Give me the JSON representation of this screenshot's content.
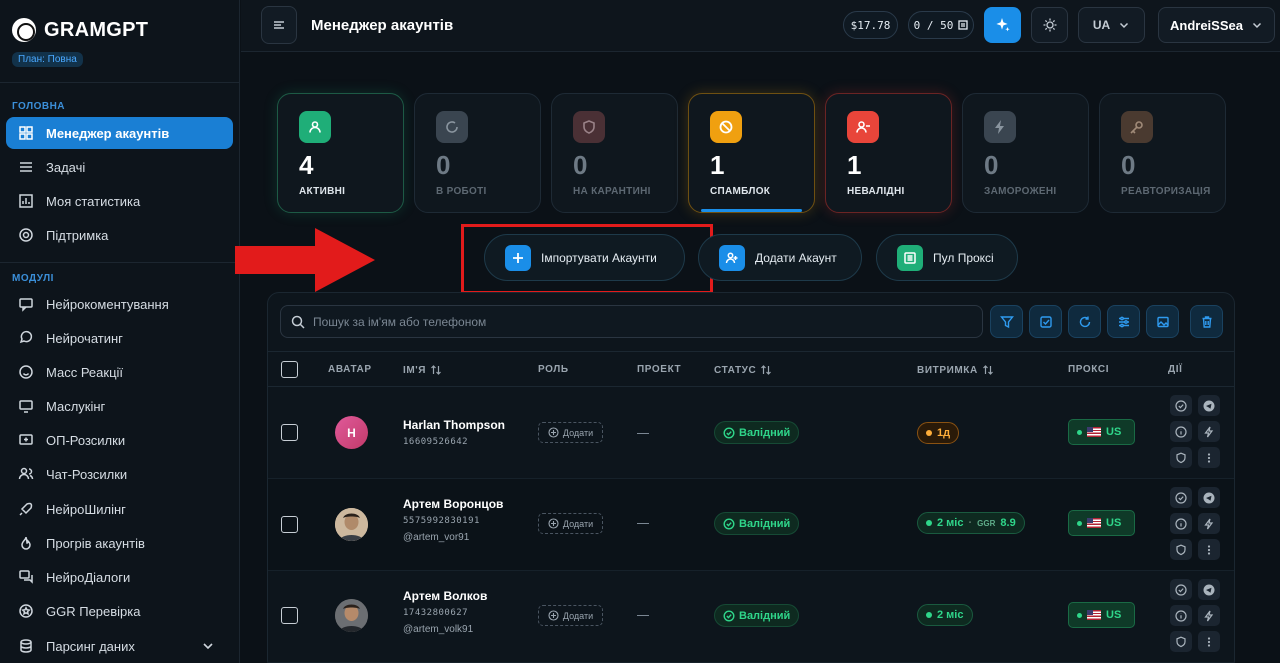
{
  "brand": {
    "title": "GRAMGPT",
    "plan": "План: Повна"
  },
  "sidebar": {
    "section_main": "ГОЛОВНА",
    "main_items": [
      {
        "label": "Менеджер акаунтів",
        "icon": "grid-icon",
        "active": true
      },
      {
        "label": "Задачі",
        "icon": "list-icon"
      },
      {
        "label": "Моя статистика",
        "icon": "chart-icon"
      },
      {
        "label": "Підтримка",
        "icon": "lifebuoy-icon"
      }
    ],
    "section_modules": "МОДУЛІ",
    "module_items": [
      {
        "label": "Нейрокоментування",
        "icon": "comment-icon"
      },
      {
        "label": "Нейрочатинг",
        "icon": "chat-icon"
      },
      {
        "label": "Масс Реакції",
        "icon": "smile-icon"
      },
      {
        "label": "Маслукінг",
        "icon": "monitor-icon"
      },
      {
        "label": "ОП-Розсилки",
        "icon": "message-plus-icon"
      },
      {
        "label": "Чат-Розсилки",
        "icon": "users-icon"
      },
      {
        "label": "НейроШилінг",
        "icon": "rocket-icon"
      },
      {
        "label": "Прогрів акаунтів",
        "icon": "fire-icon"
      },
      {
        "label": "НейроДіалоги",
        "icon": "dialog-icon"
      },
      {
        "label": "GGR Перевірка",
        "icon": "star-badge-icon"
      },
      {
        "label": "Парсинг даних",
        "icon": "database-icon"
      }
    ]
  },
  "header": {
    "title": "Менеджер акаунтів",
    "balance": "$17.78",
    "quota": "0 / 50",
    "language": "UA",
    "user": "AndreiSSea"
  },
  "stats": [
    {
      "value": "4",
      "label": "АКТИВНІ",
      "icon": "user-icon",
      "color": "#1fae78"
    },
    {
      "value": "0",
      "label": "В РОБОТІ",
      "icon": "refresh-icon",
      "color": "#3a4550"
    },
    {
      "value": "0",
      "label": "НА КАРАНТИНІ",
      "icon": "shield-icon",
      "color": "#4a3035"
    },
    {
      "value": "1",
      "label": "СПАМБЛОК",
      "icon": "ban-icon",
      "color": "#f0a010"
    },
    {
      "value": "1",
      "label": "НЕВАЛІДНІ",
      "icon": "user-x-icon",
      "color": "#e8453a"
    },
    {
      "value": "0",
      "label": "ЗАМОРОЖЕНІ",
      "icon": "bolt-icon",
      "color": "#3a4550"
    },
    {
      "value": "0",
      "label": "РЕАВТОРИЗАЦІЯ",
      "icon": "key-icon",
      "color": "#4a3a30"
    }
  ],
  "actions": {
    "import": "Імпортувати Акаунти",
    "add": "Додати Акаунт",
    "proxy_pool": "Пул Проксі"
  },
  "table": {
    "search_placeholder": "Пошук за ім'ям або телефоном",
    "headers": {
      "avatar": "АВАТАР",
      "name": "ІМ'Я",
      "role": "РОЛЬ",
      "project": "ПРОЕКТ",
      "status": "СТАТУС",
      "endurance": "ВИТРИМКА",
      "proxy": "ПРОКСІ",
      "actions": "ДІЇ"
    },
    "role_add": "Додати",
    "project_empty": "—",
    "rows": [
      {
        "avatar_letter": "H",
        "name": "Harlan Thompson",
        "phone": "16609526642",
        "username": "",
        "status": "Валідний",
        "endurance": "1д",
        "endurance_type": "orange",
        "ggr_label": "",
        "ggr": "",
        "proxy": "US"
      },
      {
        "avatar_letter": "",
        "name": "Артем Воронцов",
        "phone": "5575992830191",
        "username": "@artem_vor91",
        "status": "Валідний",
        "endurance": "2 міс",
        "endurance_type": "green",
        "ggr_label": "GGR",
        "ggr": "8.9",
        "proxy": "US"
      },
      {
        "avatar_letter": "",
        "name": "Артем Волков",
        "phone": "17432800627",
        "username": "@artem_volk91",
        "status": "Валідний",
        "endurance": "2 міс",
        "endurance_type": "green",
        "ggr_label": "",
        "ggr": "",
        "proxy": "US"
      }
    ]
  }
}
